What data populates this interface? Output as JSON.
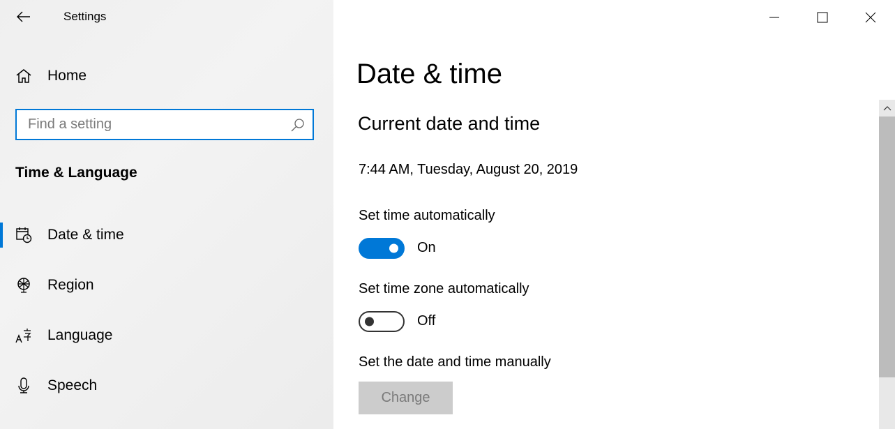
{
  "window": {
    "app_title": "Settings",
    "controls": {
      "minimize": "minimize-icon",
      "maximize": "maximize-icon",
      "close": "close-icon"
    }
  },
  "sidebar": {
    "home_label": "Home",
    "search": {
      "placeholder": "Find a setting",
      "value": ""
    },
    "section_title": "Time & Language",
    "items": [
      {
        "label": "Date & time",
        "icon": "calendar-clock-icon",
        "selected": true
      },
      {
        "label": "Region",
        "icon": "globe-icon",
        "selected": false
      },
      {
        "label": "Language",
        "icon": "language-icon",
        "selected": false
      },
      {
        "label": "Speech",
        "icon": "microphone-icon",
        "selected": false
      }
    ]
  },
  "main": {
    "page_title": "Date & time",
    "section_heading": "Current date and time",
    "current_datetime": "7:44 AM, Tuesday, August 20, 2019",
    "settings": [
      {
        "label": "Set time automatically",
        "state": "On",
        "enabled": true
      },
      {
        "label": "Set time zone automatically",
        "state": "Off",
        "enabled": false
      }
    ],
    "manual": {
      "label": "Set the date and time manually",
      "button": "Change",
      "button_disabled": true
    }
  },
  "colors": {
    "accent": "#0078d7",
    "sidebar_bg": "#f0f0f0",
    "disabled_button": "#cccccc"
  }
}
